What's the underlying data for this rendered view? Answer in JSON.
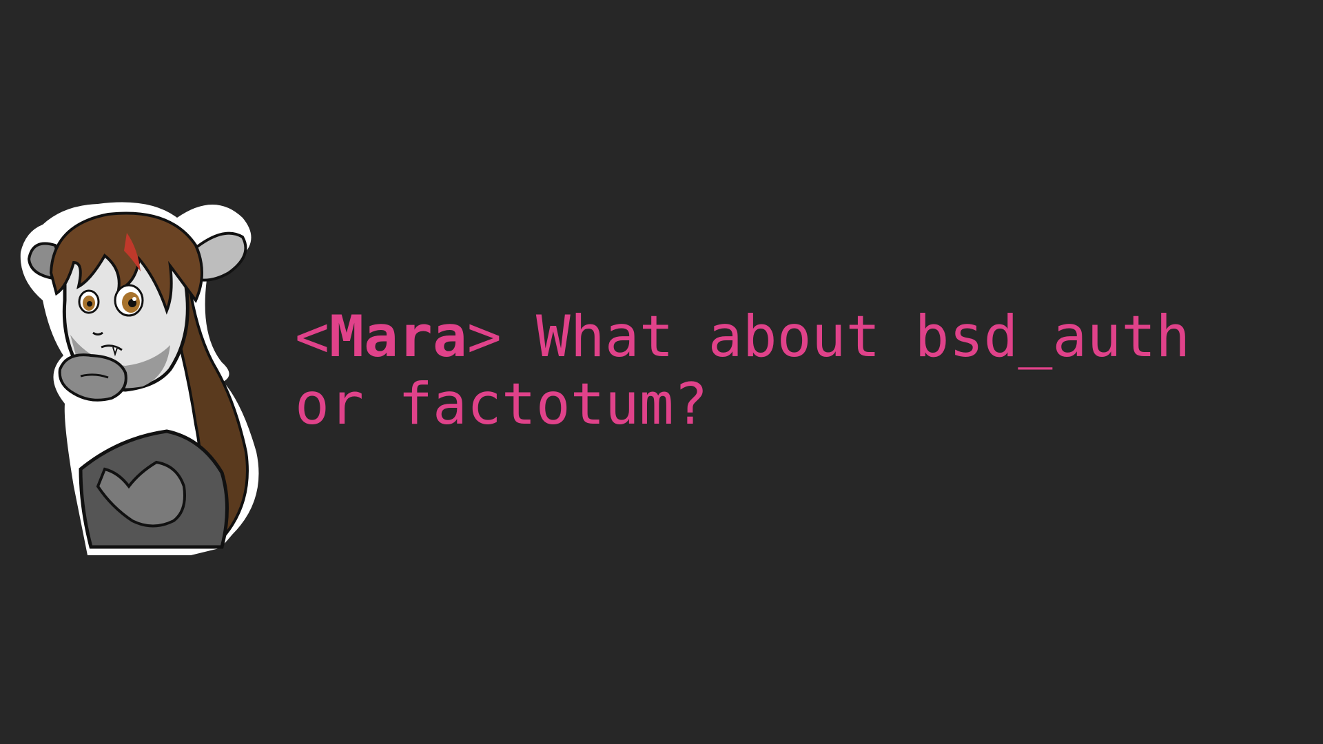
{
  "scene": {
    "background_color": "#272727",
    "accent_color": "#e0428a"
  },
  "character": {
    "icon": "character-sticker-icon",
    "name": "Mara"
  },
  "message": {
    "bracket_open": "<",
    "speaker": "Mara",
    "bracket_close": "> ",
    "text": "What about bsd_auth or factotum?"
  }
}
